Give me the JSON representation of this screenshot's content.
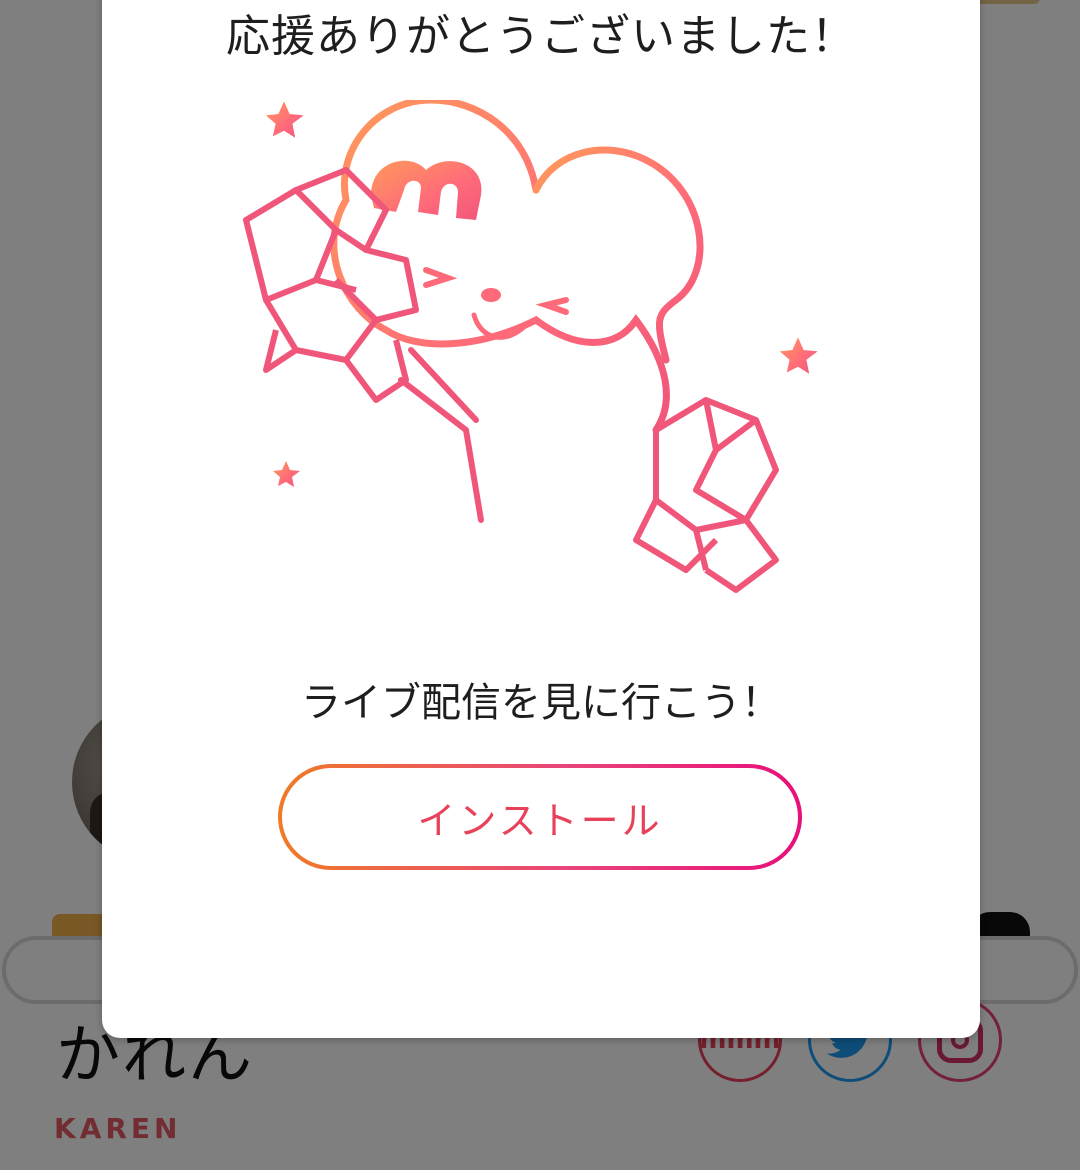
{
  "profile": {
    "name_jp": "かれん",
    "name_en": "KAREN",
    "social": {
      "mixch_label": "mmm"
    }
  },
  "modal": {
    "title": "応援ありがとうございました！",
    "cta_text": "ライブ配信を見に行こう！",
    "install_label": "インストール"
  },
  "colors": {
    "accent": "#e8415a",
    "gradient_start": "#f07a26",
    "gradient_end": "#e80f7b",
    "overlay": "rgba(0,0,0,0.5)"
  },
  "icons": {
    "mascot": "cheering-mouse-mascot-illustration",
    "twitter": "twitter-bird-icon",
    "instagram": "instagram-icon",
    "mixch": "mixch-logo-icon"
  }
}
